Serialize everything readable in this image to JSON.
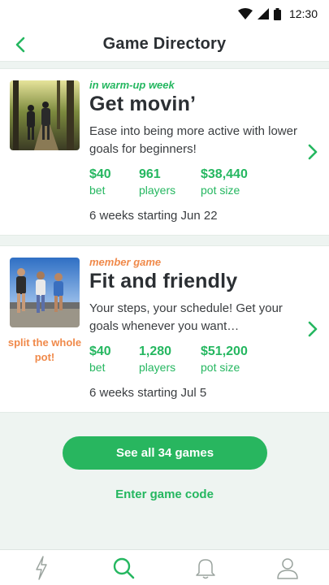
{
  "status_bar": {
    "time": "12:30"
  },
  "header": {
    "title": "Game Directory"
  },
  "games": [
    {
      "tag": "in warm-up week",
      "tag_color": "#25b760",
      "title": "Get movin’",
      "description": "Ease into being more active with lower goals for beginners!",
      "stats": [
        {
          "value": "$40",
          "label": "bet"
        },
        {
          "value": "961",
          "label": "players"
        },
        {
          "value": "$38,440",
          "label": "pot size"
        }
      ],
      "schedule": "6 weeks starting Jun 22"
    },
    {
      "tag": "member game",
      "tag_color": "#f08a4b",
      "title": "Fit and friendly",
      "side_note": "split the whole pot!",
      "description": "Your steps, your schedule! Get your goals whenever you want…",
      "stats": [
        {
          "value": "$40",
          "label": "bet"
        },
        {
          "value": "1,280",
          "label": "players"
        },
        {
          "value": "$51,200",
          "label": "pot size"
        }
      ],
      "schedule": "6 weeks starting Jul 5"
    }
  ],
  "actions": {
    "see_all_label": "See all 34 games",
    "enter_code_label": "Enter game code"
  },
  "bottom_nav": [
    {
      "name": "activity",
      "icon": "lightning-icon",
      "active": false
    },
    {
      "name": "search",
      "icon": "search-icon",
      "active": true
    },
    {
      "name": "notifications",
      "icon": "bell-icon",
      "active": false
    },
    {
      "name": "profile",
      "icon": "person-icon",
      "active": false
    }
  ],
  "colors": {
    "accent": "#25b760",
    "orange": "#f08a4b",
    "background": "#eef4f1"
  }
}
